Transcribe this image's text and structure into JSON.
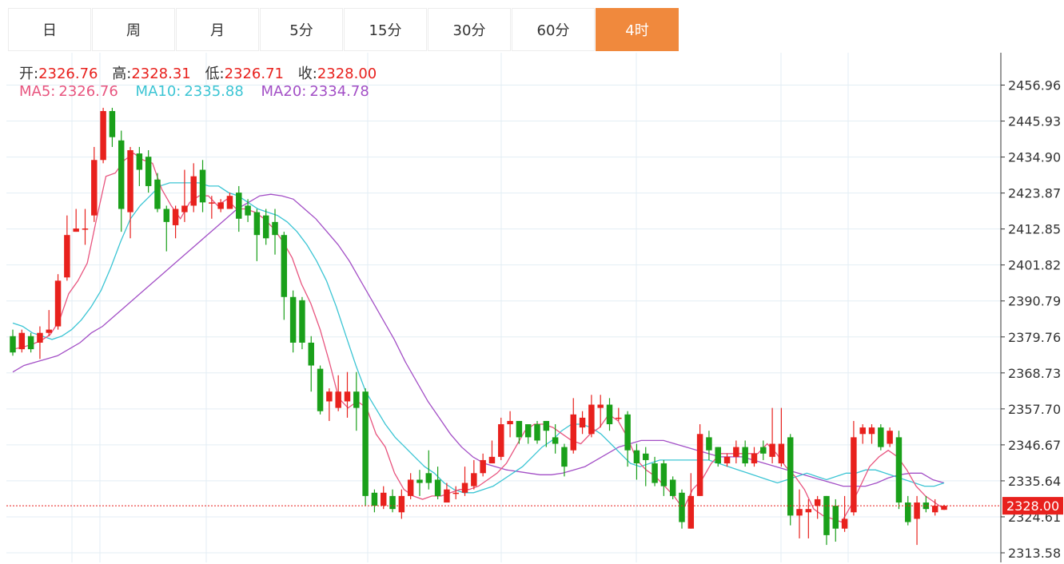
{
  "tabs": [
    {
      "label": "日",
      "active": false
    },
    {
      "label": "周",
      "active": false
    },
    {
      "label": "月",
      "active": false
    },
    {
      "label": "5分",
      "active": false
    },
    {
      "label": "15分",
      "active": false
    },
    {
      "label": "30分",
      "active": false
    },
    {
      "label": "60分",
      "active": false
    },
    {
      "label": "4时",
      "active": true
    }
  ],
  "ohlc_legend": {
    "open_label": "开:",
    "open": "2326.76",
    "high_label": "高:",
    "high": "2328.31",
    "low_label": "低:",
    "low": "2326.71",
    "close_label": "收:",
    "close": "2328.00"
  },
  "ma_legend": {
    "ma5_label": "MA5:",
    "ma5": "2326.76",
    "ma10_label": "MA10:",
    "ma10": "2335.88",
    "ma20_label": "MA20:",
    "ma20": "2334.78"
  },
  "colors": {
    "up": "#e8211d",
    "down": "#1aa01a",
    "ma5": "#e8557f",
    "ma10": "#3cc5d4",
    "ma20": "#a34fc6",
    "price_line": "#e8211d",
    "grid": "#e3eef4",
    "accent": "#f0893d",
    "value_text": "#e8211d"
  },
  "current_price": "2328.00",
  "chart_data": {
    "type": "candlestick",
    "y_ticks": [
      "2456.96",
      "2445.93",
      "2434.90",
      "2423.87",
      "2412.85",
      "2401.82",
      "2390.79",
      "2379.76",
      "2368.73",
      "2357.70",
      "2346.67",
      "2335.64",
      "2324.61",
      "2313.58"
    ],
    "ylim": [
      2312,
      2465
    ],
    "grid": true,
    "candles": [
      [
        2380,
        2375,
        2382,
        2374
      ],
      [
        2376,
        2381,
        2382,
        2375
      ],
      [
        2380,
        2376,
        2381,
        2375
      ],
      [
        2378,
        2381,
        2383,
        2373
      ],
      [
        2381,
        2382,
        2388,
        2380
      ],
      [
        2383,
        2397,
        2399,
        2382
      ],
      [
        2398,
        2411,
        2417,
        2397
      ],
      [
        2412,
        2413,
        2419,
        2412
      ],
      [
        2413,
        2413,
        2419,
        2408
      ],
      [
        2417,
        2434,
        2438,
        2415
      ],
      [
        2434,
        2449,
        2450,
        2433
      ],
      [
        2449,
        2441,
        2450,
        2438
      ],
      [
        2440,
        2419,
        2443,
        2412
      ],
      [
        2418,
        2437,
        2438,
        2410
      ],
      [
        2436,
        2431,
        2438,
        2426
      ],
      [
        2435,
        2426,
        2437,
        2424
      ],
      [
        2428,
        2419,
        2430,
        2418
      ],
      [
        2419,
        2415,
        2420,
        2406
      ],
      [
        2414,
        2419,
        2420,
        2410
      ],
      [
        2418,
        2420,
        2431,
        2415
      ],
      [
        2420,
        2429,
        2433,
        2418
      ],
      [
        2431,
        2421,
        2434,
        2418
      ],
      [
        2421,
        2421,
        2423,
        2416
      ],
      [
        2419,
        2421,
        2422,
        2418
      ],
      [
        2419,
        2423,
        2424,
        2419
      ],
      [
        2424,
        2416,
        2426,
        2412
      ],
      [
        2420,
        2417,
        2422,
        2415
      ],
      [
        2418,
        2411,
        2419,
        2403
      ],
      [
        2417,
        2410,
        2419,
        2408
      ],
      [
        2415,
        2411,
        2419,
        2405
      ],
      [
        2411,
        2392,
        2412,
        2385
      ],
      [
        2392,
        2378,
        2394,
        2375
      ],
      [
        2391,
        2378,
        2392,
        2376
      ],
      [
        2378,
        2371,
        2380,
        2363
      ],
      [
        2370,
        2357,
        2371,
        2356
      ],
      [
        2360,
        2363,
        2364,
        2354
      ],
      [
        2358,
        2363,
        2368,
        2357
      ],
      [
        2360,
        2363,
        2369,
        2355
      ],
      [
        2363,
        2358,
        2369,
        2351
      ],
      [
        2363,
        2331,
        2364,
        2328
      ],
      [
        2332,
        2328,
        2333,
        2326
      ],
      [
        2328,
        2332,
        2334,
        2327
      ],
      [
        2331,
        2327,
        2333,
        2326
      ],
      [
        2326,
        2331,
        2333,
        2324
      ],
      [
        2331,
        2336,
        2338,
        2330
      ],
      [
        2336,
        2335,
        2339,
        2331
      ],
      [
        2338,
        2335,
        2345,
        2333
      ],
      [
        2336,
        2331,
        2340,
        2330
      ],
      [
        2329,
        2333,
        2335,
        2330
      ],
      [
        2332,
        2332,
        2334,
        2330
      ],
      [
        2332,
        2335,
        2340,
        2331
      ],
      [
        2334,
        2338,
        2342,
        2333
      ],
      [
        2338,
        2342,
        2344,
        2337
      ],
      [
        2341,
        2343,
        2348,
        2341
      ],
      [
        2343,
        2353,
        2355,
        2342
      ],
      [
        2353,
        2354,
        2357,
        2349
      ],
      [
        2354,
        2349,
        2354,
        2347
      ],
      [
        2353,
        2349,
        2353,
        2347
      ],
      [
        2353,
        2348,
        2354,
        2347
      ],
      [
        2354,
        2351,
        2354,
        2346
      ],
      [
        2349,
        2347,
        2353,
        2344
      ],
      [
        2346,
        2340,
        2347,
        2337
      ],
      [
        2345,
        2356,
        2361,
        2344
      ],
      [
        2352,
        2355,
        2357,
        2350
      ],
      [
        2350,
        2359,
        2362,
        2349
      ],
      [
        2358,
        2359,
        2362,
        2352
      ],
      [
        2359,
        2353,
        2361,
        2351
      ],
      [
        2355,
        2355,
        2358,
        2354
      ],
      [
        2356,
        2345,
        2357,
        2340
      ],
      [
        2345,
        2341,
        2347,
        2336
      ],
      [
        2344,
        2342,
        2346,
        2334
      ],
      [
        2341,
        2335,
        2343,
        2334
      ],
      [
        2341,
        2334,
        2342,
        2331
      ],
      [
        2336,
        2331,
        2337,
        2330
      ],
      [
        2332,
        2323,
        2333,
        2321
      ],
      [
        2321,
        2331,
        2338,
        2321
      ],
      [
        2331,
        2350,
        2353,
        2331
      ],
      [
        2349,
        2345,
        2351,
        2342
      ],
      [
        2346,
        2341,
        2346,
        2340
      ],
      [
        2341,
        2343,
        2344,
        2340
      ],
      [
        2343,
        2346,
        2348,
        2341
      ],
      [
        2346,
        2341,
        2348,
        2340
      ],
      [
        2341,
        2344,
        2346,
        2340
      ],
      [
        2346,
        2344,
        2348,
        2342
      ],
      [
        2343,
        2347,
        2358,
        2341
      ],
      [
        2341,
        2347,
        2358,
        2340
      ],
      [
        2349,
        2325,
        2350,
        2322
      ],
      [
        2325,
        2327,
        2333,
        2318
      ],
      [
        2326,
        2327,
        2330,
        2318
      ],
      [
        2328,
        2330,
        2331,
        2324
      ],
      [
        2331,
        2319,
        2331,
        2316
      ],
      [
        2328,
        2321,
        2330,
        2317
      ],
      [
        2321,
        2324,
        2331,
        2320
      ],
      [
        2326,
        2349,
        2354,
        2325
      ],
      [
        2350,
        2352,
        2353,
        2347
      ],
      [
        2350,
        2352,
        2353,
        2347
      ],
      [
        2352,
        2346,
        2353,
        2345
      ],
      [
        2347,
        2351,
        2352,
        2346
      ],
      [
        2349,
        2329,
        2351,
        2327
      ],
      [
        2329,
        2323,
        2331,
        2322
      ],
      [
        2324,
        2329,
        2331,
        2316
      ],
      [
        2329,
        2327,
        2331,
        2326
      ],
      [
        2326,
        2328,
        2330,
        2325
      ],
      [
        2326.76,
        2328.0,
        2328.31,
        2326.71
      ]
    ],
    "ma5": [
      2376,
      2376.6,
      2377.4,
      2378.6,
      2380.4,
      2384.8,
      2393,
      2397,
      2402.4,
      2416,
      2429,
      2430,
      2434,
      2436,
      2434,
      2433,
      2425,
      2420,
      2416,
      2421,
      2423,
      2423,
      2420,
      2422,
      2419,
      2419,
      2418,
      2416,
      2413,
      2409,
      2404,
      2396,
      2390,
      2382,
      2372,
      2361,
      2358,
      2360,
      2358,
      2350,
      2346,
      2338,
      2333,
      2331,
      2330,
      2331,
      2331,
      2332,
      2333,
      2333,
      2334,
      2336,
      2338,
      2341,
      2346,
      2351,
      2353,
      2353,
      2352,
      2350,
      2348,
      2347,
      2350,
      2352,
      2356,
      2354,
      2349,
      2342,
      2339,
      2337,
      2334,
      2331,
      2327,
      2333,
      2336,
      2341,
      2344,
      2344,
      2344,
      2344,
      2344,
      2347,
      2344,
      2340,
      2337,
      2333,
      2327,
      2325,
      2324,
      2323,
      2328,
      2334,
      2340,
      2343,
      2345,
      2343,
      2339,
      2334,
      2331,
      2329,
      2327
    ],
    "ma10": [
      2384,
      2383,
      2381,
      2380,
      2379,
      2380,
      2382,
      2385,
      2389,
      2394,
      2401,
      2409,
      2416,
      2420,
      2423,
      2426,
      2427,
      2427,
      2427,
      2427,
      2426,
      2426,
      2424,
      2423,
      2421,
      2419,
      2418,
      2417,
      2415,
      2412,
      2408,
      2403,
      2397,
      2389,
      2380,
      2371,
      2363,
      2358,
      2353,
      2349,
      2346,
      2343,
      2340,
      2338,
      2335,
      2333,
      2332,
      2332,
      2333,
      2334,
      2336,
      2338,
      2340,
      2343,
      2346,
      2348,
      2351,
      2353,
      2353,
      2352,
      2350,
      2347,
      2344,
      2341,
      2340,
      2341,
      2342,
      2342,
      2342,
      2342,
      2342,
      2342,
      2341,
      2340,
      2339,
      2338,
      2337,
      2336,
      2335,
      2336,
      2337,
      2338,
      2337,
      2336,
      2337,
      2338,
      2338,
      2339,
      2339,
      2338,
      2337,
      2336,
      2335,
      2334,
      2334,
      2335
    ],
    "ma20": [
      2369,
      2371,
      2372,
      2373,
      2374,
      2376,
      2378,
      2381,
      2383,
      2386,
      2389,
      2392,
      2395,
      2398,
      2401,
      2404,
      2407,
      2410,
      2413,
      2416,
      2419,
      2421,
      2423,
      2423.5,
      2423,
      2422,
      2419,
      2416,
      2412,
      2408,
      2403,
      2397,
      2391,
      2385,
      2379,
      2372,
      2366,
      2360,
      2355,
      2350,
      2346,
      2343,
      2341,
      2340,
      2339,
      2338.5,
      2338,
      2337.5,
      2337.5,
      2338,
      2339,
      2340,
      2342,
      2344,
      2346,
      2347,
      2348,
      2348,
      2348,
      2347,
      2346,
      2345,
      2344,
      2343,
      2343,
      2343,
      2342,
      2341,
      2340,
      2339,
      2338,
      2337,
      2336,
      2335,
      2334,
      2334,
      2334,
      2335,
      2336.5,
      2337.5,
      2338,
      2338,
      2336,
      2335
    ]
  }
}
